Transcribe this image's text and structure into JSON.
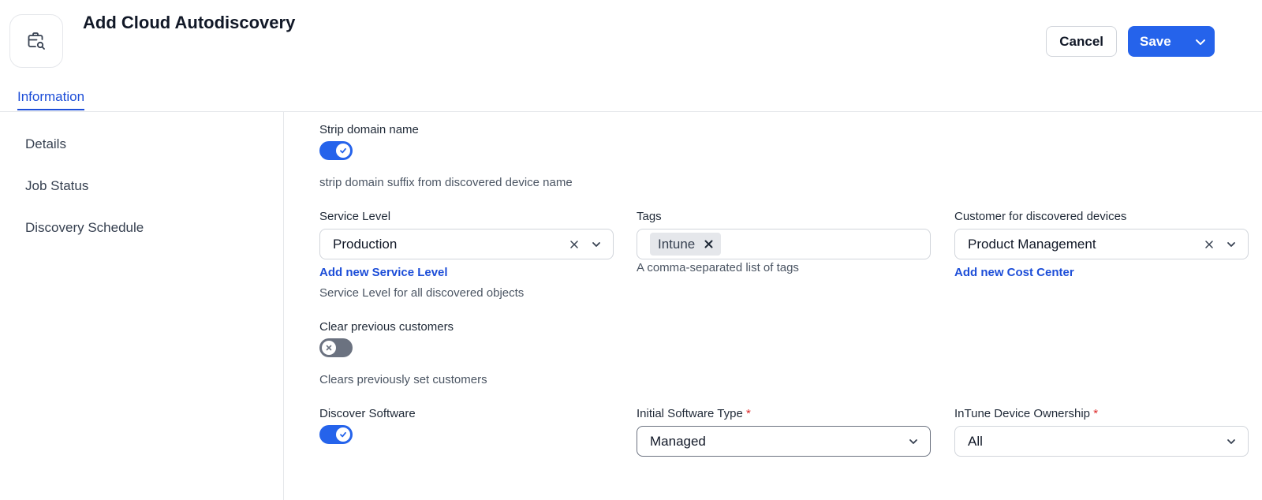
{
  "header": {
    "title": "Add Cloud Autodiscovery",
    "icon": "briefcase-search-icon",
    "cancel_label": "Cancel",
    "save_label": "Save"
  },
  "tabs": [
    {
      "label": "Information",
      "active": true
    }
  ],
  "sidebar": {
    "items": [
      {
        "label": "Details"
      },
      {
        "label": "Job Status"
      },
      {
        "label": "Discovery Schedule"
      }
    ]
  },
  "form": {
    "strip_domain": {
      "label": "Strip domain name",
      "enabled": true,
      "hint": "strip domain suffix from discovered device name"
    },
    "service_level": {
      "label": "Service Level",
      "value": "Production",
      "add_link": "Add new Service Level",
      "hint": "Service Level for all discovered objects"
    },
    "tags": {
      "label": "Tags",
      "chips": [
        "Intune"
      ],
      "hint": "A comma-separated list of tags"
    },
    "customer": {
      "label": "Customer for discovered devices",
      "value": "Product Management",
      "add_link": "Add new Cost Center"
    },
    "clear_customers": {
      "label": "Clear previous customers",
      "enabled": false,
      "hint": "Clears previously set customers"
    },
    "discover_software": {
      "label": "Discover Software",
      "enabled": true
    },
    "software_type": {
      "label": "Initial Software Type",
      "required_mark": "*",
      "value": "Managed"
    },
    "ownership": {
      "label": "InTune Device Ownership",
      "required_mark": "*",
      "value": "All"
    }
  },
  "colors": {
    "accent": "#2563eb",
    "link": "#1d4ed8",
    "required": "#dc2626",
    "toggle_off": "#6b7280"
  }
}
